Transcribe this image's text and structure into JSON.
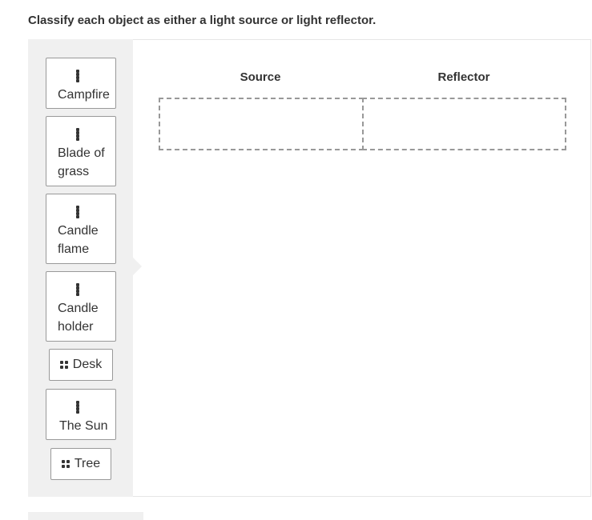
{
  "question": "Classify each object as either a light source or light reflector.",
  "items": [
    {
      "label": "Campfire"
    },
    {
      "label": "Blade of grass"
    },
    {
      "label": "Candle flame"
    },
    {
      "label": "Candle holder"
    },
    {
      "label": "Desk"
    },
    {
      "label": "The Sun"
    },
    {
      "label": "Tree"
    }
  ],
  "categories": [
    {
      "label": "Source"
    },
    {
      "label": "Reflector"
    }
  ],
  "grip_icon": "drag-handle-icon"
}
